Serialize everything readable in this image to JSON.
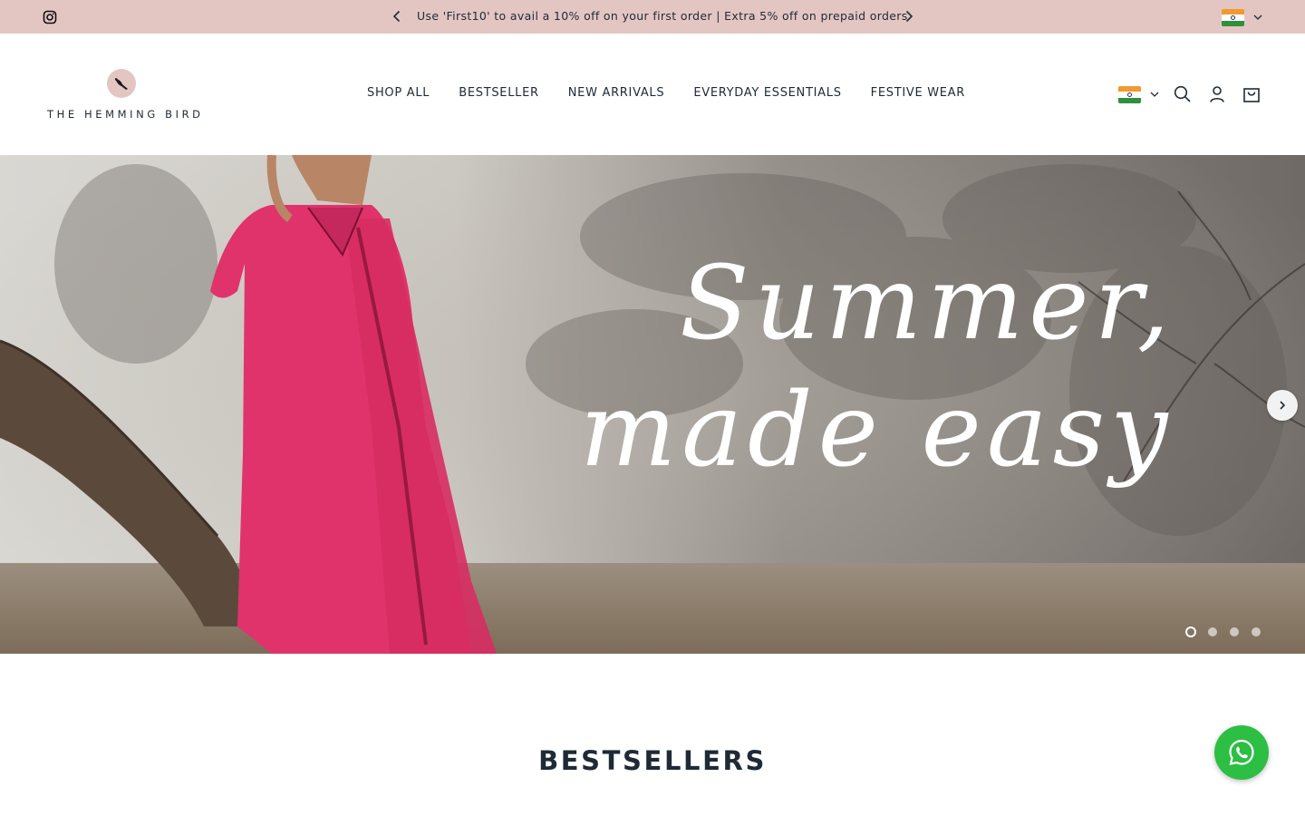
{
  "announcement": {
    "message": "Use 'First10' to avail a 10% off on your first order | Extra 5% off on prepaid orders",
    "background": "#e3c6c1"
  },
  "header": {
    "brand": "THE HEMMING BIRD",
    "nav": [
      "SHOP ALL",
      "BESTSELLER",
      "NEW ARRIVALS",
      "EVERYDAY ESSENTIALS",
      "FESTIVE WEAR"
    ],
    "icons": [
      "flag-india-icon",
      "search-icon",
      "account-icon",
      "cart-icon"
    ]
  },
  "hero": {
    "headline_line1": "Summer,",
    "headline_line2": "made easy",
    "slide_count": 4,
    "active_slide": 1
  },
  "sections": {
    "bestsellers_title": "BESTSELLERS"
  },
  "colors": {
    "accent": "#e3c6c1",
    "text": "#1f2a37",
    "whatsapp": "#2dbe44"
  }
}
